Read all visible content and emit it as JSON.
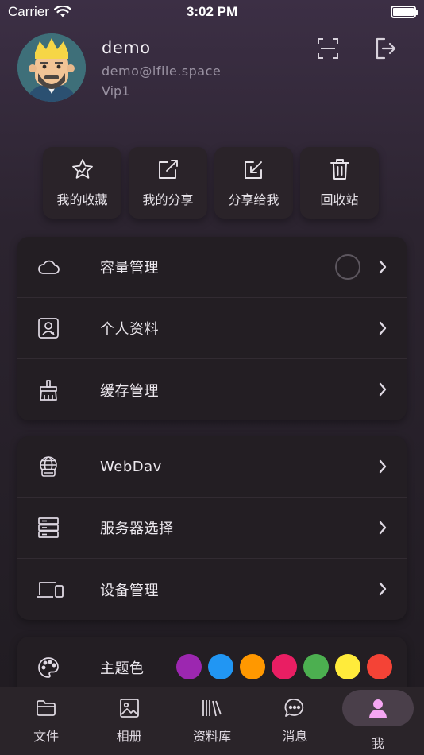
{
  "status_bar": {
    "carrier": "Carrier",
    "time": "3:02 PM"
  },
  "profile": {
    "name": "demo",
    "email": "demo@ifile.space",
    "level": "Vip1"
  },
  "quick_actions": [
    {
      "label": "我的收藏",
      "icon": "star-icon"
    },
    {
      "label": "我的分享",
      "icon": "share-out-icon"
    },
    {
      "label": "分享给我",
      "icon": "share-in-icon"
    },
    {
      "label": "回收站",
      "icon": "trash-icon"
    }
  ],
  "menu_group_1": [
    {
      "label": "容量管理",
      "icon": "cloud-icon"
    },
    {
      "label": "个人资料",
      "icon": "profile-card-icon"
    },
    {
      "label": "缓存管理",
      "icon": "broom-icon"
    }
  ],
  "menu_group_2": [
    {
      "label": "WebDav",
      "icon": "globe-icon"
    },
    {
      "label": "服务器选择",
      "icon": "server-icon"
    },
    {
      "label": "设备管理",
      "icon": "devices-icon"
    }
  ],
  "theme": {
    "label": "主题色",
    "colors": [
      "#9c27b0",
      "#2196f3",
      "#ff9800",
      "#e91e63",
      "#4caf50",
      "#ffeb3b",
      "#f44336"
    ]
  },
  "tabs": [
    {
      "label": "文件",
      "icon": "folder-icon"
    },
    {
      "label": "相册",
      "icon": "photo-icon"
    },
    {
      "label": "资料库",
      "icon": "library-icon"
    },
    {
      "label": "消息",
      "icon": "message-icon"
    },
    {
      "label": "我",
      "icon": "person-icon",
      "active": true
    }
  ]
}
